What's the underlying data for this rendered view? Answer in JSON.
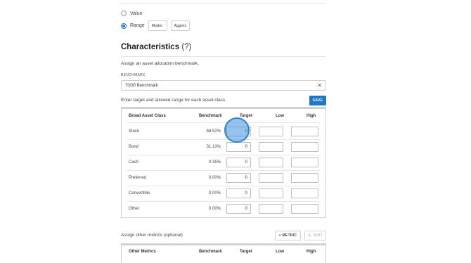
{
  "radio_options": [
    {
      "label": "Value",
      "checked": false
    },
    {
      "label": "Range",
      "checked": true
    }
  ],
  "range_buttons": [
    "Moder",
    "Aggres"
  ],
  "characteristics": {
    "title": "Characteristics",
    "help": "(?)",
    "subtitle": "Assign an asset allocation benchmark.",
    "benchmark_label": "BENCHMARK",
    "benchmark_value": "70/30 Benchmark",
    "clear_icon": "close-icon",
    "instruction": "Enter target and allowed range for each asset class.",
    "save_label": "SAVE"
  },
  "asset_table": {
    "headers": [
      "Broad Asset Class",
      "Benchmark",
      "Target",
      "Low",
      "High"
    ],
    "rows": [
      {
        "name": "Stock",
        "benchmark": "68.52%",
        "target": "0"
      },
      {
        "name": "Bond",
        "benchmark": "31.13%",
        "target": "0"
      },
      {
        "name": "Cash",
        "benchmark": "0.35%",
        "target": "0"
      },
      {
        "name": "Preferred",
        "benchmark": "0.00%",
        "target": "0"
      },
      {
        "name": "Convertible",
        "benchmark": "0.00%",
        "target": "0"
      },
      {
        "name": "Other",
        "benchmark": "0.00%",
        "target": "0"
      }
    ]
  },
  "other_metrics": {
    "label": "Assign other metrics (optional)",
    "metric_button": "+ METRIC",
    "edit_button": "EDIT",
    "edit_icon": "pencil-icon",
    "headers": [
      "Other Metrics",
      "Benchmark",
      "Target",
      "Low",
      "High"
    ]
  },
  "colors": {
    "accent": "#1f78c9",
    "focus": "#3e91de"
  }
}
